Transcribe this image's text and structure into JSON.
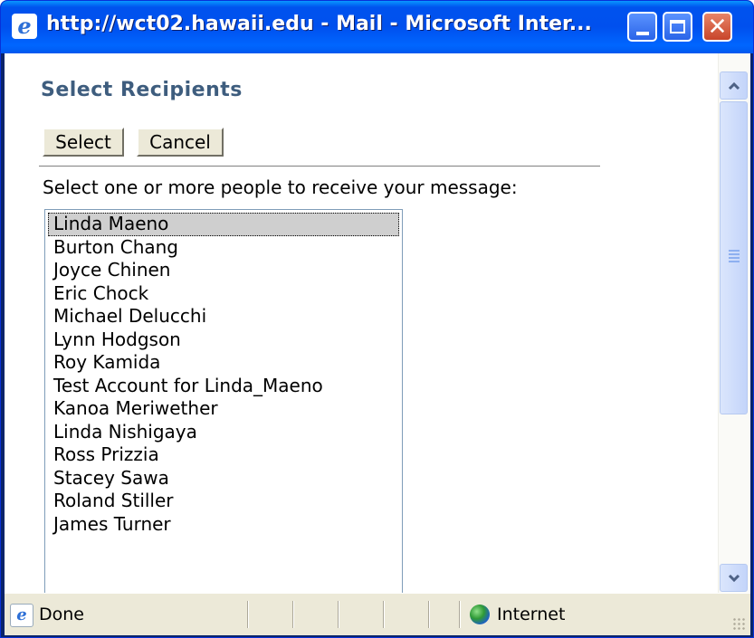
{
  "window": {
    "title": "http://wct02.hawaii.edu - Mail - Microsoft Inter...",
    "minimize_icon": "minimize-icon",
    "maximize_icon": "maximize-icon",
    "close_icon": "close-icon"
  },
  "page": {
    "heading": "Select Recipients",
    "select_label": "Select",
    "cancel_label": "Cancel",
    "instructions": "Select one or more people to receive your message:"
  },
  "recipients": [
    "Linda Maeno",
    "Burton Chang",
    "Joyce Chinen",
    "Eric Chock",
    "Michael Delucchi",
    "Lynn Hodgson",
    "Roy Kamida",
    "Test Account for Linda_Maeno",
    "Kanoa Meriwether",
    "Linda Nishigaya",
    "Ross Prizzia",
    "Stacey Sawa",
    "Roland Stiller",
    "James Turner"
  ],
  "selected_recipient": "Linda Maeno",
  "statusbar": {
    "status": "Done",
    "zone": "Internet"
  },
  "colors": {
    "titlebar": "#0054e3",
    "heading": "#3e5d7e",
    "button_face": "#ece9d8"
  }
}
